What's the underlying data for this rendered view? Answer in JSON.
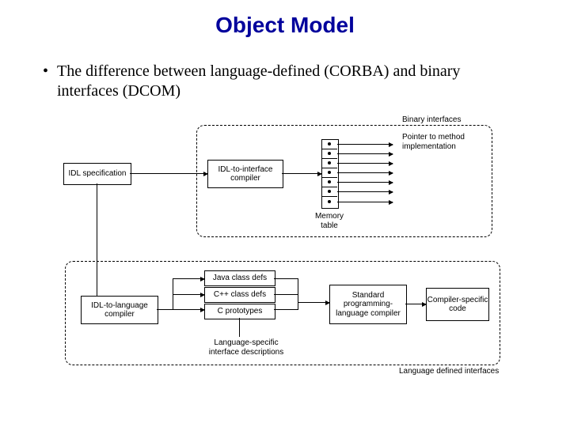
{
  "title": "Object Model",
  "bullet": "The difference between language-defined (CORBA) and binary interfaces (DCOM)",
  "labels": {
    "binary_interfaces": "Binary interfaces",
    "pointer_to_method": "Pointer to method implementation",
    "idl_spec": "IDL specification",
    "idl_to_interface": "IDL-to-interface compiler",
    "memory_table": "Memory table",
    "idl_to_language": "IDL-to-language compiler",
    "java_class_defs": "Java class defs",
    "cpp_class_defs": "C++ class defs",
    "c_prototypes": "C prototypes",
    "std_compiler": "Standard programming-language compiler",
    "compiler_specific_code": "Compiler-specific code",
    "lang_specific_desc": "Language-specific interface descriptions",
    "lang_defined_interfaces": "Language defined interfaces"
  }
}
